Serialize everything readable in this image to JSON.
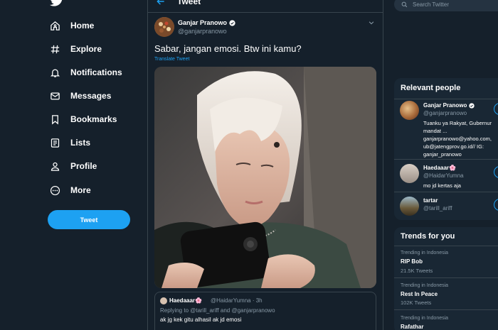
{
  "nav": {
    "logo_icon": "twitter-bird-icon",
    "items": [
      {
        "label": "Home",
        "icon": "home-icon"
      },
      {
        "label": "Explore",
        "icon": "hashtag-icon"
      },
      {
        "label": "Notifications",
        "icon": "bell-icon"
      },
      {
        "label": "Messages",
        "icon": "envelope-icon"
      },
      {
        "label": "Bookmarks",
        "icon": "bookmark-icon"
      },
      {
        "label": "Lists",
        "icon": "list-icon"
      },
      {
        "label": "Profile",
        "icon": "person-icon"
      },
      {
        "label": "More",
        "icon": "more-circle-icon"
      }
    ],
    "tweet_button": "Tweet"
  },
  "main": {
    "header_title": "Tweet",
    "tweet": {
      "author_name": "Ganjar Pranowo",
      "author_handle": "@ganjarpranowo",
      "text": "Sabar, jangan emosi. Btw ini kamu?",
      "translate_label": "Translate Tweet"
    },
    "quote": {
      "name": "Haedaaar🌸",
      "handle_time": "@HaidarYumna · 3h",
      "replying_to": "Replying to @tarill_ariff and @ganjarpranowo",
      "text": "ak jg kek gitu alhasil ak jd emosi"
    }
  },
  "sidebar": {
    "search_placeholder": "Search Twitter",
    "relevant_title": "Relevant people",
    "people": [
      {
        "name": "Ganjar Pranowo",
        "handle": "@ganjarpranowo",
        "verified": true,
        "bio": "Tuanku ya Rakyat, Gubernur mandat ... ganjarpranowo@yahoo.com, ub@jatengprov.go.id// IG: ganjar_pranowo"
      },
      {
        "name": "Haedaaar🌸",
        "handle": "@HaidarYumna",
        "verified": false,
        "bio": "mo jd kertas aja"
      },
      {
        "name": "tartar",
        "handle": "@tarill_ariff",
        "verified": false,
        "bio": ""
      }
    ],
    "trends_title": "Trends for you",
    "trends": [
      {
        "meta": "Trending in Indonesia",
        "name": "RIP Bob",
        "count": "21.5K Tweets"
      },
      {
        "meta": "Trending in Indonesia",
        "name": "Rest In Peace",
        "count": "102K Tweets"
      },
      {
        "meta": "Trending in Indonesia",
        "name": "Rafathar",
        "count": ""
      }
    ]
  },
  "colors": {
    "background": "#15202b",
    "panel": "#192734",
    "accent": "#1da1f2",
    "border": "#38444d",
    "muted_text": "#8899a6"
  }
}
